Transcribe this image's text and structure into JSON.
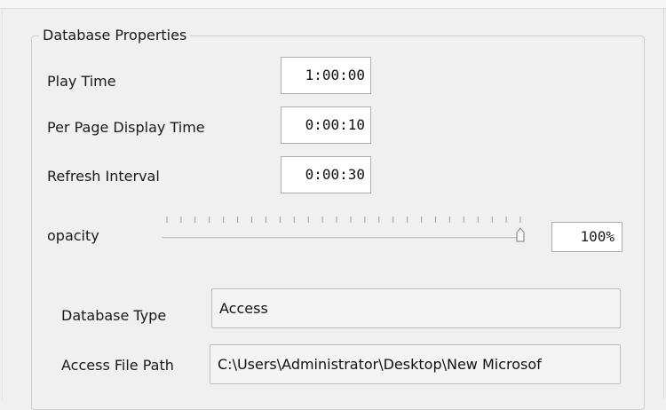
{
  "groupbox": {
    "title": "Database Properties"
  },
  "fields": {
    "play_time": {
      "label": "Play Time",
      "value": "1:00:00"
    },
    "per_page_display_time": {
      "label": "Per Page Display Time",
      "value": "0:00:10"
    },
    "refresh_interval": {
      "label": "Refresh Interval",
      "value": "0:00:30"
    }
  },
  "opacity": {
    "label": "opacity",
    "value_text": "100%",
    "value_fraction": 1.0
  },
  "database_type": {
    "label": "Database Type",
    "value": "Access"
  },
  "access_file_path": {
    "label": "Access File Path",
    "value": "C:\\Users\\Administrator\\Desktop\\New Microsof"
  }
}
